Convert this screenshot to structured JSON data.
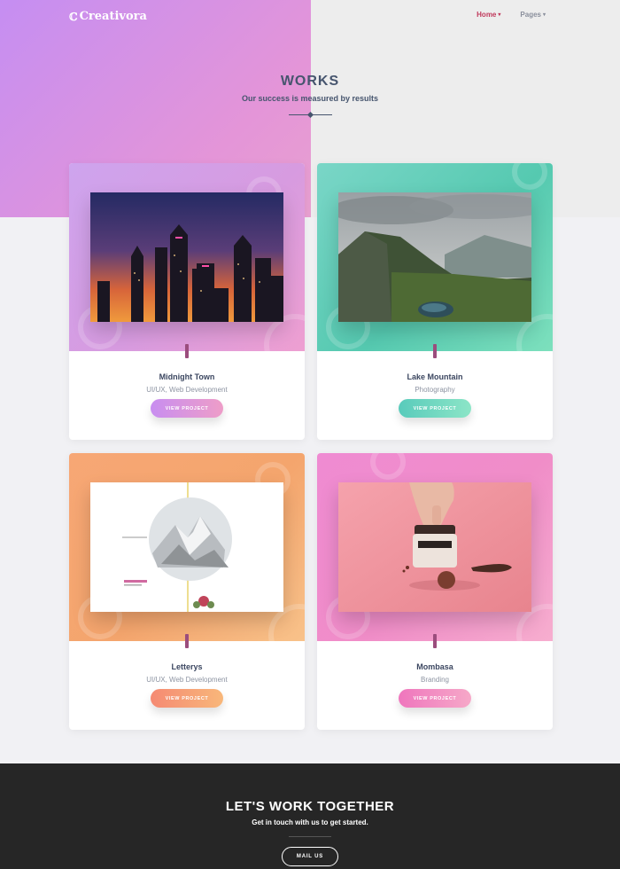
{
  "brand": {
    "name": "Creativora",
    "icon": "creativora-logo-icon"
  },
  "nav": {
    "items": [
      {
        "label": "Home",
        "state": "active"
      },
      {
        "label": "Pages",
        "state": "inactive"
      }
    ]
  },
  "works": {
    "title": "WORKS",
    "subtitle": "Our success is measured by results"
  },
  "projects": [
    {
      "title": "Midnight Town",
      "category": "UI/UX, Web Development",
      "button": "VIEW PROJECT",
      "theme": "purple",
      "image": "city-skyline-at-dusk-image"
    },
    {
      "title": "Lake Mountain",
      "category": "Photography",
      "button": "VIEW PROJECT",
      "theme": "teal",
      "image": "mountain-lake-landscape-image"
    },
    {
      "title": "Letterys",
      "category": "UI/UX, Web Development",
      "button": "VIEW PROJECT",
      "theme": "orange",
      "image": "snowy-peak-editorial-layout-image"
    },
    {
      "title": "Mombasa",
      "category": "Branding",
      "button": "VIEW PROJECT",
      "theme": "pink",
      "image": "cosmetic-jar-product-photo-image"
    }
  ],
  "footer": {
    "title": "LET'S WORK TOGETHER",
    "subtitle": "Get in touch with us to get started.",
    "button": "MAIL US"
  },
  "colors": {
    "accent": "#c0395c",
    "heading": "#46556e",
    "footer_bg": "#262626"
  }
}
